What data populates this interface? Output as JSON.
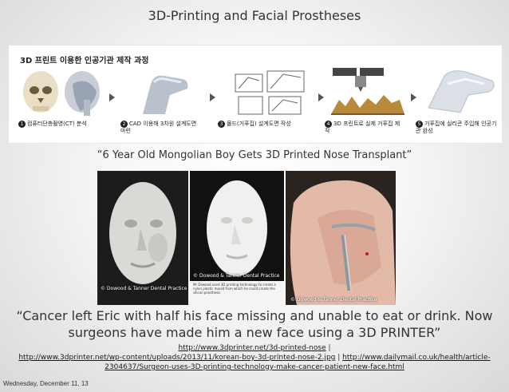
{
  "slide": {
    "title": "3D-Printing and Facial Prostheses"
  },
  "diagram": {
    "title": "3D 프린트 이용한 인공기관 제작 과정",
    "steps": [
      {
        "num": "1",
        "label": "컴퓨터단층촬영(CT) 분석"
      },
      {
        "num": "2",
        "label": "CAD 이용해 3차원 설계도면 마련"
      },
      {
        "num": "3",
        "label": "몰드(거푸집) 설계도면 작성"
      },
      {
        "num": "4",
        "label": "3D 프린트로 실제 거푸집 제작"
      },
      {
        "num": "5",
        "label": "거푸집에 실리콘 주입해 인공기관 완성"
      }
    ]
  },
  "quote1": "“6 Year Old Mongolian Boy Gets 3D Printed Nose Transplant”",
  "photos": {
    "credit1": "© Dowood & Tanner Dental Practice",
    "credit2": "© Dowood & Tanner Dental Practice",
    "credit3": "© Dowood & Tanner Dental Practice",
    "caption2": "Mr Dowood used 3D printing technology to create a nylon plastic mould from which he could create the silicon prosthesis"
  },
  "quote2": "“Cancer left Eric with half his face missing and unable to eat or drink. Now surgeons have made him a new face using a 3D PRINTER”",
  "links": {
    "link1": "http://www.3dprinter.net/3d-printed-nose",
    "sep1": " | ",
    "link2": "http://www.3dprinter.net/wp-content/uploads/2013/11/korean-boy-3d-printed-nose-2.jpg",
    "sep2": " | ",
    "link3": "http://www.dailymail.co.uk/health/article-2304637/Surgeon-uses-3D-printing-technology-make-cancer-patient-new-face.html"
  },
  "footer": {
    "date": "Wednesday, December 11, 13"
  }
}
